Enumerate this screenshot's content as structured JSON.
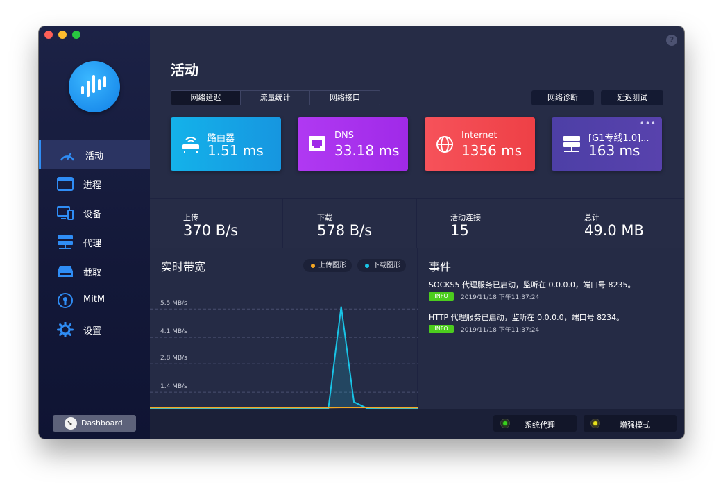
{
  "window": {
    "help_label": "?"
  },
  "sidebar": {
    "items": [
      {
        "label": "活动",
        "icon": "gauge-icon"
      },
      {
        "label": "进程",
        "icon": "window-icon"
      },
      {
        "label": "设备",
        "icon": "devices-icon"
      },
      {
        "label": "代理",
        "icon": "server-icon"
      },
      {
        "label": "截取",
        "icon": "disk-icon"
      },
      {
        "label": "MitM",
        "icon": "keyhole-icon"
      },
      {
        "label": "设置",
        "icon": "gear-icon"
      }
    ],
    "dashboard_label": "Dashboard"
  },
  "header": {
    "title": "活动",
    "tabs": [
      "网络延迟",
      "流量统计",
      "网络接口"
    ],
    "diag_button": "网络诊断",
    "latency_button": "延迟测试"
  },
  "cards": [
    {
      "name": "路由器",
      "value": "1.51 ms",
      "color": "#16a8e8",
      "icon": "router-icon"
    },
    {
      "name": "DNS",
      "value": "33.18 ms",
      "color": "#b037f3",
      "icon": "dns-icon"
    },
    {
      "name": "Internet",
      "value": "1356 ms",
      "color": "#f24a50",
      "icon": "globe-icon"
    },
    {
      "name": "[G1专线1.0]...",
      "value": "163 ms",
      "color": "#4f40a8",
      "icon": "server-icon"
    }
  ],
  "more_label": "•••",
  "stats": [
    {
      "label": "上传",
      "value": "370 B/s"
    },
    {
      "label": "下载",
      "value": "578 B/s"
    },
    {
      "label": "活动连接",
      "value": "15"
    },
    {
      "label": "总计",
      "value": "49.0 MB"
    }
  ],
  "bandwidth": {
    "title": "实时带宽",
    "legend_upload": "上传图形",
    "legend_download": "下载图形",
    "upload_color": "#f5a623",
    "download_color": "#19c4e6"
  },
  "chart_data": {
    "type": "area",
    "title": "实时带宽",
    "y_tick_labels": [
      "5.5 MB/s",
      "4.1 MB/s",
      "2.8 MB/s",
      "1.4 MB/s"
    ],
    "y_ticks": [
      5.5,
      4.1,
      2.8,
      1.4
    ],
    "ylim": [
      0,
      6.5
    ],
    "x": [
      0,
      1,
      2,
      3,
      4,
      5,
      6,
      7,
      8,
      9,
      10,
      11,
      12,
      13,
      14,
      15,
      16,
      17,
      18,
      19,
      20,
      21
    ],
    "series": [
      {
        "name": "上传图形",
        "values": [
          0,
          0,
          0,
          0,
          0,
          0,
          0,
          0,
          0,
          0,
          0,
          0,
          0,
          0,
          0,
          0.01,
          0.01,
          0.01,
          0,
          0,
          0,
          0
        ]
      },
      {
        "name": "下载图形",
        "values": [
          0,
          0,
          0,
          0,
          0,
          0,
          0,
          0,
          0,
          0,
          0,
          0,
          0,
          0,
          0,
          5.0,
          0.3,
          0,
          0,
          0,
          0,
          0
        ]
      }
    ],
    "grid": true
  },
  "events": {
    "title": "事件",
    "items": [
      {
        "text": "SOCKS5 代理服务已启动，监听在 0.0.0.0，端口号 8235。",
        "level": "INFO",
        "time": "2019/11/18 下午11:37:24"
      },
      {
        "text": "HTTP 代理服务已启动，监听在 0.0.0.0，端口号 8234。",
        "level": "INFO",
        "time": "2019/11/18 下午11:37:24"
      }
    ]
  },
  "footer": {
    "system_proxy": "系统代理",
    "enhanced_mode": "增强模式",
    "system_proxy_color": "#37d31d",
    "enhanced_mode_color": "#e8e21a"
  }
}
